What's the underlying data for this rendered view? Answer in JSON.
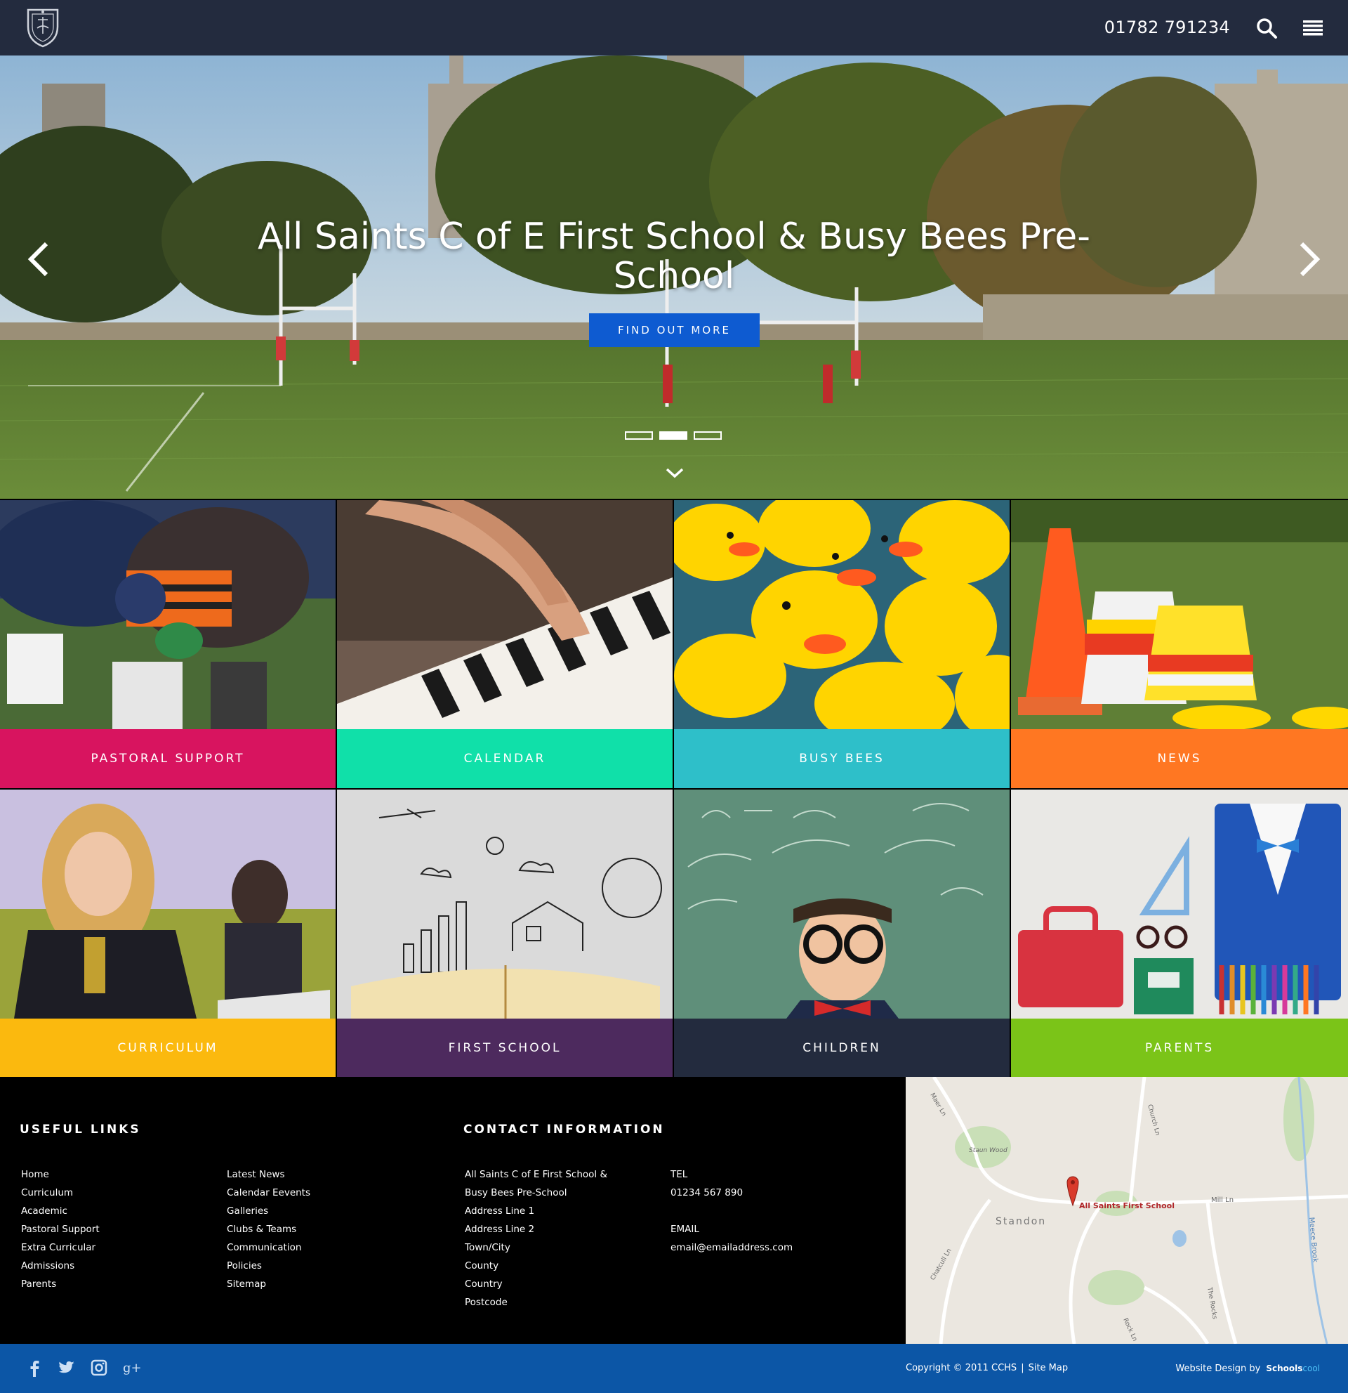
{
  "header": {
    "phone": "01782 791234",
    "search_icon": "search-icon",
    "menu_icon": "hamburger-menu-icon",
    "logo_icon": "school-crest-logo"
  },
  "hero": {
    "title": "All Saints C of E First School & Busy Bees Pre-School",
    "cta_label": "FIND OUT MORE",
    "slides_total": 3,
    "active_slide": 2
  },
  "tiles": [
    {
      "label": "PASTORAL SUPPORT",
      "color": "#d8145f"
    },
    {
      "label": "CALENDAR",
      "color": "#10e0a9"
    },
    {
      "label": "BUSY BEES",
      "color": "#2ebfc9"
    },
    {
      "label": "NEWS",
      "color": "#ff7722"
    },
    {
      "label": "CURRICULUM",
      "color": "#fbb90e"
    },
    {
      "label": "FIRST SCHOOL",
      "color": "#4d2a5e"
    },
    {
      "label": "CHILDREN",
      "color": "#232b3e"
    },
    {
      "label": "PARENTS",
      "color": "#7bc418"
    }
  ],
  "footer": {
    "useful_links_title": "USEFUL LINKS",
    "links_col1": [
      "Home",
      "Curriculum",
      "Academic",
      "Pastoral Support",
      "Extra Curricular",
      "Admissions",
      "Parents"
    ],
    "links_col2": [
      "Latest News",
      "Calendar Eevents",
      "Galleries",
      "Clubs & Teams",
      "Communication",
      "Policies",
      "Sitemap"
    ],
    "contact_title": "CONTACT INFORMATION",
    "address": [
      "All Saints C of E First School &",
      "Busy Bees Pre-School",
      "Address Line 1",
      "Address Line 2",
      "Town/City",
      "County",
      "Country",
      "Postcode"
    ],
    "tel_label": "TEL",
    "tel": "01234 567 890",
    "email_label": "EMAIL",
    "email": "email@emailaddress.com"
  },
  "map": {
    "marker_label": "All Saints First School",
    "place_labels": [
      "Staun Wood",
      "Standon",
      "Mill Ln",
      "Maer Ln",
      "Church Ln",
      "Chatcull Ln",
      "The Rocks",
      "Meece Brook",
      "Rock Ln"
    ]
  },
  "bottombar": {
    "social_icons": [
      "facebook-icon",
      "twitter-icon",
      "instagram-icon",
      "google-plus-icon"
    ],
    "copyright": "Copyright © 2011 CCHS",
    "separator": "|",
    "sitemap_link": "Site Map",
    "credit_text": "Website Design by",
    "brand_main": "Schools",
    "brand_accent": "cool"
  },
  "colors": {
    "header_bg": "#232b3e",
    "cta_blue": "#0e5bd1",
    "bottombar_bg": "#0c56a6",
    "map_marker": "#d93a2b"
  }
}
